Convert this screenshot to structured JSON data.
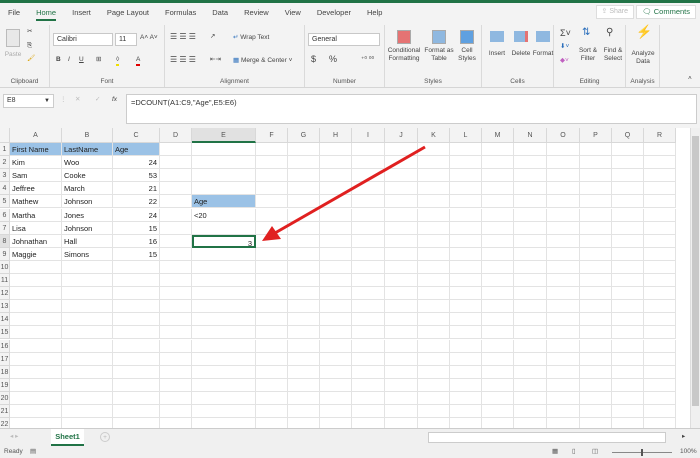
{
  "menu": {
    "items": [
      "File",
      "Home",
      "Insert",
      "Page Layout",
      "Formulas",
      "Data",
      "Review",
      "View",
      "Developer",
      "Help"
    ],
    "active": "Home",
    "share": "Share",
    "comments": "Comments"
  },
  "ribbon": {
    "clipboard": {
      "label": "Clipboard",
      "paste": "Paste"
    },
    "font": {
      "label": "Font",
      "name": "Calibri",
      "size": "11",
      "bold": "B",
      "italic": "I",
      "underline": "U"
    },
    "alignment": {
      "label": "Alignment",
      "wrap": "Wrap Text",
      "merge": "Merge & Center"
    },
    "number": {
      "label": "Number",
      "format": "General",
      "currency": "$",
      "percent": "%"
    },
    "styles": {
      "label": "Styles",
      "conditional": "Conditional Formatting",
      "format_table": "Format as Table",
      "cell_styles": "Cell Styles"
    },
    "cells": {
      "label": "Cells",
      "insert": "Insert",
      "delete": "Delete",
      "format": "Format"
    },
    "editing": {
      "label": "Editing",
      "sort": "Sort & Filter",
      "find": "Find & Select"
    },
    "analysis": {
      "label": "Analysis",
      "analyze": "Analyze Data"
    }
  },
  "formula_bar": {
    "name_box": "E8",
    "formula": "=DCOUNT(A1:C9,\"Age\",E5:E6)"
  },
  "sheet": {
    "columns": [
      "A",
      "B",
      "C",
      "D",
      "E",
      "F",
      "G",
      "H",
      "I",
      "J",
      "K",
      "L",
      "M",
      "N",
      "O",
      "P",
      "Q",
      "R"
    ],
    "row_count": 22,
    "header_fill": "#9bc2e6",
    "table": {
      "headers": [
        "First Name",
        "LastName",
        "Age"
      ],
      "rows": [
        [
          "Kim",
          "Woo",
          "24"
        ],
        [
          "Sam",
          "Cooke",
          "53"
        ],
        [
          "Jeffree",
          "March",
          "21"
        ],
        [
          "Mathew",
          "Johnson",
          "22"
        ],
        [
          "Martha",
          "Jones",
          "24"
        ],
        [
          "Lisa",
          "Johnson",
          "15"
        ],
        [
          "Johnathan",
          "Hall",
          "16"
        ],
        [
          "Maggie",
          "Simons",
          "15"
        ]
      ]
    },
    "criteria": {
      "header": "Age",
      "value": "<20"
    },
    "result": "3",
    "selected_cell": "E8",
    "annotation_arrow_color": "#e02020"
  },
  "tabs": {
    "sheets": [
      "Sheet1"
    ],
    "active": "Sheet1"
  },
  "status": {
    "ready": "Ready",
    "zoom": "100%"
  }
}
